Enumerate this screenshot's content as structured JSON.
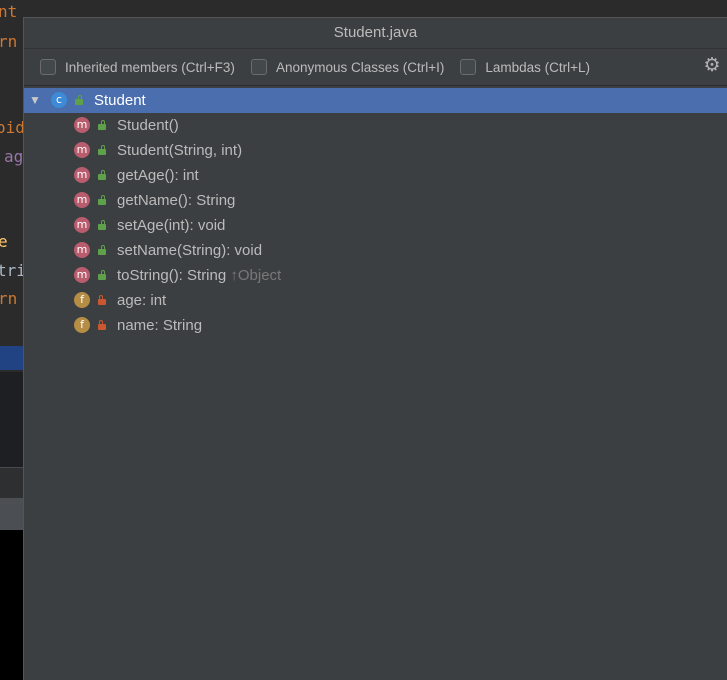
{
  "editor": {
    "lines": [
      {
        "text": "nt getAge() {",
        "color": "#cc7832"
      },
      {
        "text": "rn",
        "color": "#cc7832"
      },
      {
        "text": "oid",
        "color": "#cc7832"
      },
      {
        "text": "ag",
        "color": "#9876aa"
      },
      {
        "text": "e",
        "color": "#ffc66d"
      },
      {
        "text": "tri",
        "color": "#a9b7c6"
      },
      {
        "text": "rn",
        "color": "#cc7832"
      }
    ]
  },
  "popup": {
    "title": "Student.java",
    "filters": {
      "inherited": {
        "label": "Inherited members (Ctrl+F3)",
        "checked": false
      },
      "anonymous": {
        "label": "Anonymous Classes (Ctrl+I)",
        "checked": false
      },
      "lambdas": {
        "label": "Lambdas (Ctrl+L)",
        "checked": false
      }
    },
    "settings_icon": "gear-icon",
    "tree": {
      "root": {
        "name": "Student",
        "kind": "class",
        "badge": "c",
        "access": "public",
        "expanded": true,
        "selected": true
      },
      "members": [
        {
          "badge": "m",
          "access": "public",
          "text": "Student()",
          "inherited": ""
        },
        {
          "badge": "m",
          "access": "public",
          "text": "Student(String, int)",
          "inherited": ""
        },
        {
          "badge": "m",
          "access": "public",
          "text": "getAge(): int",
          "inherited": ""
        },
        {
          "badge": "m",
          "access": "public",
          "text": "getName(): String",
          "inherited": ""
        },
        {
          "badge": "m",
          "access": "public",
          "text": "setAge(int): void",
          "inherited": ""
        },
        {
          "badge": "m",
          "access": "public",
          "text": "setName(String): void",
          "inherited": ""
        },
        {
          "badge": "m",
          "access": "public",
          "text": "toString(): String ",
          "inherited": "↑Object"
        },
        {
          "badge": "f",
          "access": "private",
          "text": "age: int",
          "inherited": ""
        },
        {
          "badge": "f",
          "access": "private",
          "text": "name: String",
          "inherited": ""
        }
      ]
    }
  },
  "colors": {
    "selection": "#4b6eaf",
    "popup_bg": "#3c3f41",
    "method_badge": "#b85c6e",
    "field_badge": "#b58d44",
    "class_badge": "#3d8bd6",
    "public_lock": "#5fa04a",
    "private_lock": "#c9572f"
  }
}
